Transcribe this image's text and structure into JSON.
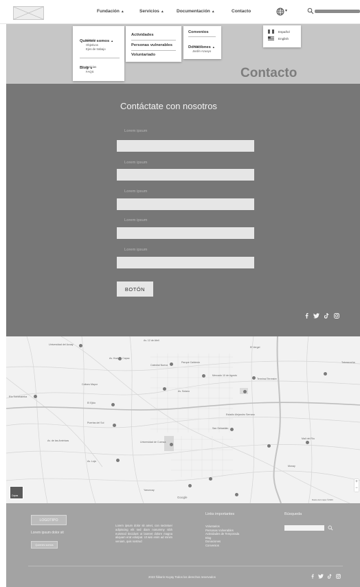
{
  "nav": {
    "items": [
      {
        "label": "Fundación",
        "caret": "▲"
      },
      {
        "label": "Servicios",
        "caret": "▲"
      },
      {
        "label": "Documentación",
        "caret": "▲"
      },
      {
        "label": "Contacto",
        "caret": ""
      }
    ],
    "globe_caret": "▾",
    "icons": [
      "image-placeholder-icon",
      "globe-icon",
      "search-icon"
    ]
  },
  "hero": {
    "title": "Contacto"
  },
  "menu_fundacion": {
    "quienes": "Quienes somos",
    "quienes_caret": "▲",
    "quienes_items": [
      "Historia",
      "Objetivos",
      "Ejes de trabajo"
    ],
    "blog": "Blog",
    "blog_caret": "▲",
    "blog_items": [
      "Noticias",
      "FAQS"
    ]
  },
  "menu_servicios": {
    "items": [
      "Actividades",
      "Personas vulnerables",
      "Voluntariado"
    ]
  },
  "menu_documentacion": {
    "convenios": "Convenios",
    "donaciones": "Donaciones",
    "donaciones_caret": "▲",
    "donaciones_items": [
      "PAMAC",
      "Jardín Azuayo"
    ]
  },
  "languages": [
    {
      "label": "Español",
      "flag": "mexico-flag-icon"
    },
    {
      "label": "English",
      "flag": "usa-flag-icon"
    }
  ],
  "form": {
    "title": "Contáctate con nosotros",
    "fields": [
      {
        "label": "Lorem ipsum"
      },
      {
        "label": "Lorem ipsum"
      },
      {
        "label": "Lorem ipsum"
      },
      {
        "label": "Lorem ipsum"
      },
      {
        "label": "Lorem ipsum"
      }
    ],
    "button": "BOTÓN"
  },
  "social": {
    "icons": [
      "facebook-icon",
      "twitter-icon",
      "tiktok-icon",
      "instagram-icon"
    ]
  },
  "map": {
    "labels": [
      "Universidad del Azuay",
      "Av. 12 de Abril",
      "Parque Calderón",
      "Catedral Nueva",
      "Mercado 10 de Agosto",
      "El Vergel",
      "Av. Huayna Capac",
      "Coliseo Mayor",
      "El Ejido",
      "Totoracocha",
      "Av. Solano",
      "Río Tomebamba",
      "Estadio Alejandro Serrano",
      "Puertas del Sol",
      "Av. de las Américas",
      "Universidad de Cuenca",
      "Av. Loja",
      "San Sebastián",
      "Terminal Terrestre",
      "Yanuncay",
      "Mall del Río",
      "Monay"
    ],
    "thumb": "Capas",
    "google": "Google",
    "zoom": [
      "+",
      "−"
    ],
    "attribution": "Datos del mapa ©2023"
  },
  "footer": {
    "logo": "LOGOTIPO",
    "tagline": "Lorem ipsum dolor sit",
    "button": "Quienes somos",
    "paragraph": "Lorem ipsum dolor sit amet, con sectetuer adipiscing elit sed diam nonummy nibh euismod tincidunt ut laoreet dolore magna aliquam erat volutpat. Ut wisi enim ad minim veniam, quis nostrud",
    "links_title": "Links importantes",
    "links": [
      "Voluntarios",
      "Personas Vulnerables",
      "Actividades de Temporada",
      "Blog",
      "Donaciones",
      "Convenios"
    ],
    "search_title": "Búsqueda",
    "copyright": "2023 Ñikarin Kuyay Todos los derechos reservados"
  },
  "colors": {
    "hero": "#c6c6c6",
    "form_bg": "#777777",
    "footer_bg": "#a3a3a3",
    "input_bg": "#e6e6e6"
  }
}
